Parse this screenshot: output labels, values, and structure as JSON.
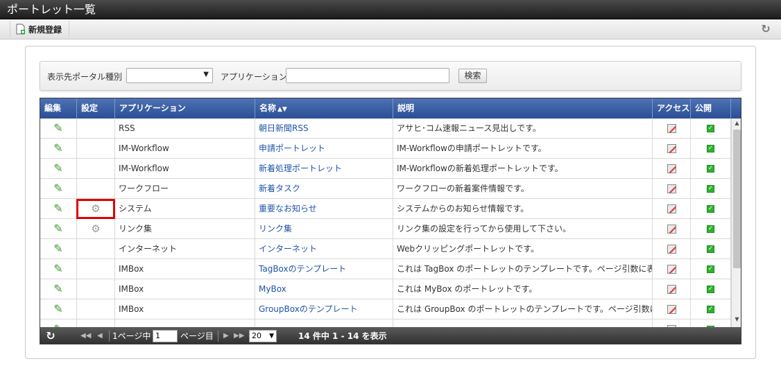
{
  "window": {
    "title": "ポートレット一覧"
  },
  "toolbar": {
    "new_label": "新規登録",
    "new_icon": "new-document-icon",
    "refresh_icon": "refresh-icon"
  },
  "search": {
    "portal_type_label": "表示先ポータル種別",
    "portal_type_value": "",
    "application_label": "アプリケーション",
    "application_value": "",
    "search_button": "検索"
  },
  "grid": {
    "columns": [
      "編集",
      "設定",
      "アプリケーション",
      "名称",
      "説明",
      "アクセス",
      "公開"
    ],
    "sort_column": "名称",
    "rows": [
      {
        "edit": true,
        "settings": false,
        "application": "RSS",
        "name": "朝日新聞RSS",
        "description": "アサヒ･コム速報ニュース見出しです。",
        "public": true
      },
      {
        "edit": true,
        "settings": false,
        "application": "IM-Workflow",
        "name": "申請ポートレット",
        "description": "IM-Workflowの申請ポートレットです。",
        "public": true
      },
      {
        "edit": true,
        "settings": false,
        "application": "IM-Workflow",
        "name": "新着処理ポートレット",
        "description": "IM-Workflowの新着処理ポートレットです。",
        "public": true
      },
      {
        "edit": true,
        "settings": false,
        "application": "ワークフロー",
        "name": "新着タスク",
        "description": "ワークフローの新着案件情報です。",
        "public": true
      },
      {
        "edit": true,
        "settings": true,
        "application": "システム",
        "name": "重要なお知らせ",
        "description": "システムからのお知らせ情報です。",
        "public": true
      },
      {
        "edit": true,
        "settings": true,
        "application": "リンク集",
        "name": "リンク集",
        "description": "リンク集の設定を行ってから使用して下さい。",
        "public": true
      },
      {
        "edit": true,
        "settings": false,
        "application": "インターネット",
        "name": "インターネット",
        "description": "Webクリッピングポートレットです。",
        "public": true
      },
      {
        "edit": true,
        "settings": false,
        "application": "IMBox",
        "name": "TagBoxのテンプレート",
        "description": "これは TagBox のポートレットのテンプレートです。ページ引数に表示したい",
        "public": true
      },
      {
        "edit": true,
        "settings": false,
        "application": "IMBox",
        "name": "MyBox",
        "description": "これは MyBox のポートレットです。",
        "public": true
      },
      {
        "edit": true,
        "settings": false,
        "application": "IMBox",
        "name": "GroupBoxのテンプレート",
        "description": "これは GroupBox のポートレットのテンプレートです。ページ引数に表示し",
        "public": true
      },
      {
        "edit": true,
        "settings": false,
        "application": "",
        "name": "",
        "description": "",
        "public": true
      }
    ]
  },
  "pager": {
    "page_prefix": "1ページ中",
    "page_value": "1",
    "page_suffix": "ページ目",
    "rows_per_page": "20",
    "summary": "14 件中 1 - 14 を表示"
  },
  "colors": {
    "header_blue": "#2b4e95",
    "link": "#1f54a8",
    "highlight": "#e00000"
  }
}
